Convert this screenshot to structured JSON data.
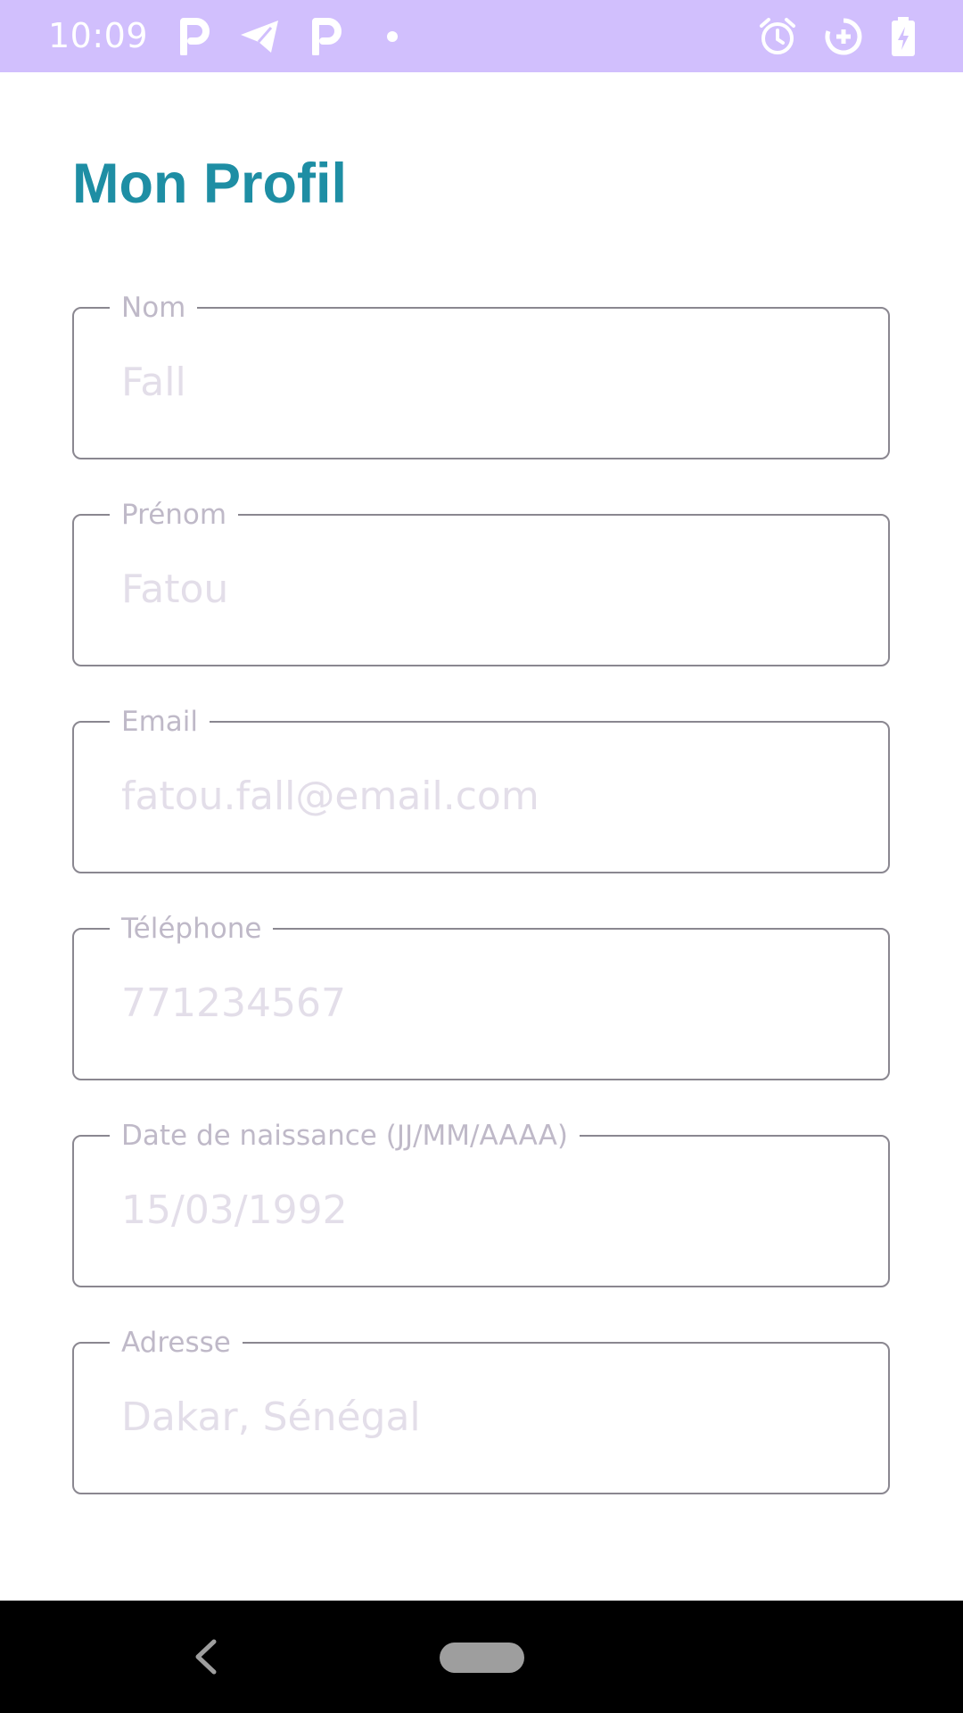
{
  "status_bar": {
    "time": "10:09",
    "left_icons": [
      "parking-p-icon",
      "telegram-send-icon",
      "parking-p-icon",
      "notification-dot-icon"
    ],
    "right_icons": [
      "alarm-clock-icon",
      "data-saver-icon",
      "battery-charging-icon"
    ],
    "background": "#d1bffd"
  },
  "page": {
    "title": "Mon Profil",
    "title_color": "#1e8ea4"
  },
  "fields": [
    {
      "label": "Nom",
      "value": "Fall"
    },
    {
      "label": "Prénom",
      "value": "Fatou"
    },
    {
      "label": "Email",
      "value": "fatou.fall@email.com"
    },
    {
      "label": "Téléphone",
      "value": "771234567"
    },
    {
      "label": "Date de naissance (JJ/MM/AAAA)",
      "value": "15/03/1992"
    },
    {
      "label": "Adresse",
      "value": "Dakar, Sénégal"
    }
  ],
  "nav_bar": {
    "icons": [
      "back-chevron-icon",
      "home-pill-icon"
    ]
  }
}
